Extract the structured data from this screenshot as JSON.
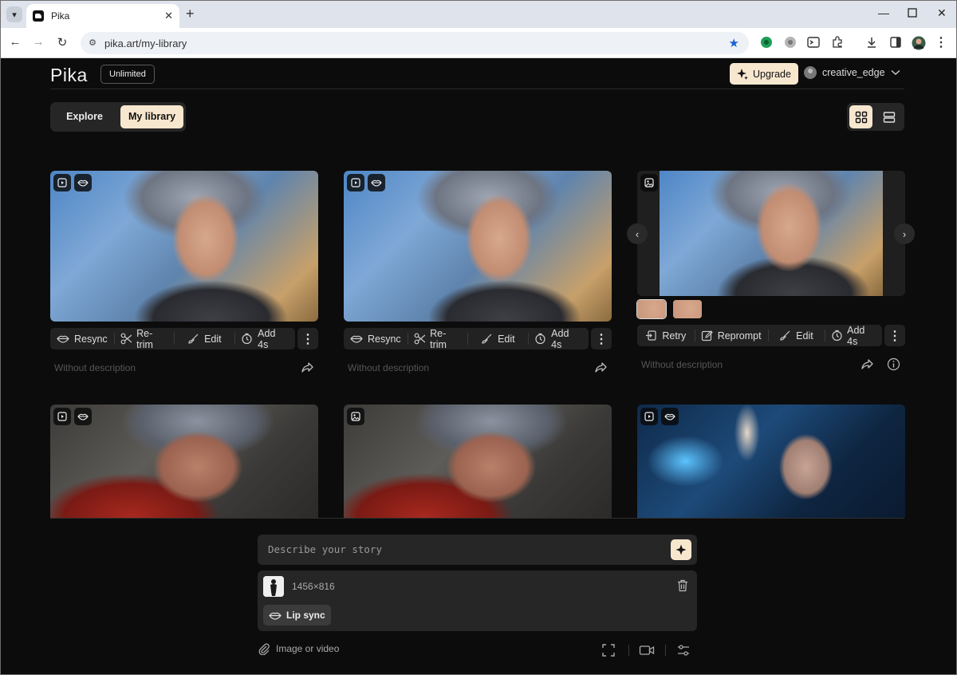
{
  "browser": {
    "tab_title": "Pika",
    "url": "pika.art/my-library"
  },
  "header": {
    "logo": "Pika",
    "plan": "Unlimited",
    "upgrade_label": "Upgrade",
    "username": "creative_edge"
  },
  "tabs": {
    "explore": "Explore",
    "library": "My library"
  },
  "cards": {
    "c1": {
      "actions": [
        "Resync",
        "Re-trim",
        "Edit",
        "Add 4s"
      ],
      "description": "Without description"
    },
    "c2": {
      "actions": [
        "Resync",
        "Re-trim",
        "Edit",
        "Add 4s"
      ],
      "description": "Without description"
    },
    "c3": {
      "actions": [
        "Retry",
        "Reprompt",
        "Edit",
        "Add 4s"
      ],
      "description": "Without description"
    }
  },
  "composer": {
    "placeholder": "Describe your story",
    "file_dims": "1456×816",
    "lip_sync_label": "Lip sync",
    "attach_label": "Image or video"
  },
  "colors": {
    "accent": "#f8e7cf",
    "background": "#0c0c0c",
    "panel": "#262626"
  }
}
